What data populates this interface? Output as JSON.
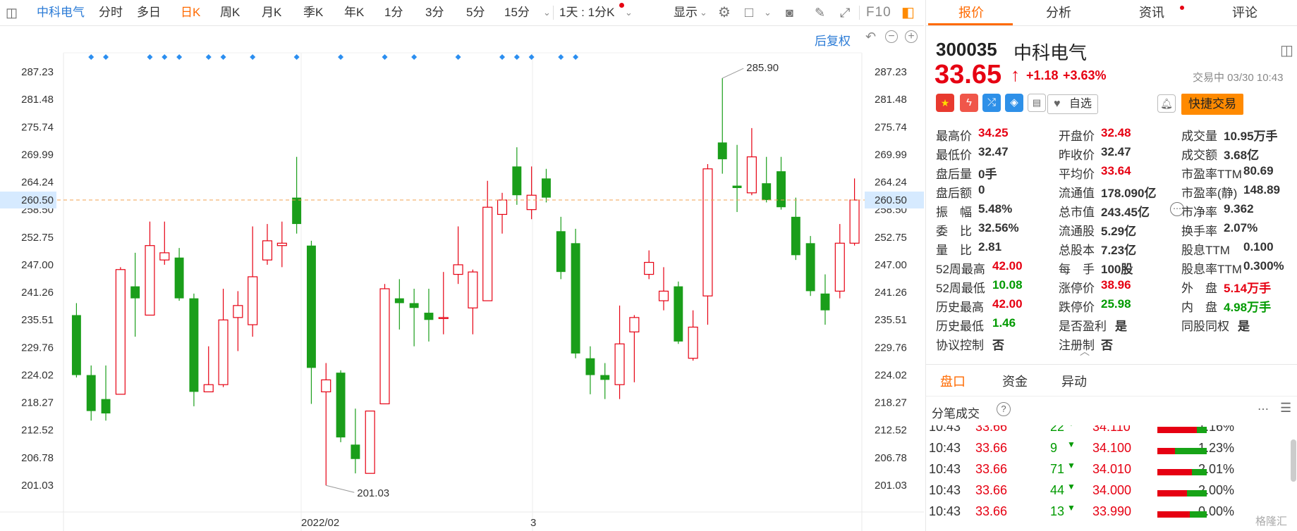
{
  "toolbar": {
    "stock_name": "中科电气",
    "periods": [
      "分时",
      "多日",
      "日K",
      "周K",
      "月K",
      "季K",
      "年K",
      "1分",
      "3分",
      "5分",
      "15分"
    ],
    "active_period": "日K",
    "range_label": "1天 : 1分K",
    "display_label": "显示",
    "f10_label": "F10"
  },
  "chart": {
    "fq_label": "后复权",
    "left_axis": [
      "287.23",
      "281.48",
      "275.74",
      "269.99",
      "264.24",
      "258.50",
      "252.75",
      "247.00",
      "241.26",
      "235.51",
      "229.76",
      "224.02",
      "218.27",
      "212.52",
      "206.78",
      "201.03"
    ],
    "crosshair_value": "260.50",
    "high_label": "285.90",
    "low_label": "201.03",
    "x_labels": [
      "2022/02",
      "3"
    ],
    "colors": {
      "up": "#e60012",
      "down": "#1a9e1a",
      "crosshair": "#f0a050",
      "marker": "#2b8ef0"
    }
  },
  "chart_data": {
    "type": "candlestick",
    "ylim": [
      201.03,
      287.23
    ],
    "candles": [
      {
        "o": 236.5,
        "h": 239.0,
        "l": 223.5,
        "c": 224.0
      },
      {
        "o": 224.0,
        "h": 226.0,
        "l": 214.5,
        "c": 216.5
      },
      {
        "o": 219.0,
        "h": 226.0,
        "l": 214.5,
        "c": 216.0
      },
      {
        "o": 220.0,
        "h": 246.5,
        "l": 220.0,
        "c": 246.0
      },
      {
        "o": 242.5,
        "h": 249.5,
        "l": 232.0,
        "c": 240.0
      },
      {
        "o": 236.5,
        "h": 256.0,
        "l": 236.5,
        "c": 251.0
      },
      {
        "o": 248.0,
        "h": 256.0,
        "l": 247.0,
        "c": 249.5
      },
      {
        "o": 248.5,
        "h": 250.5,
        "l": 239.5,
        "c": 240.0
      },
      {
        "o": 240.0,
        "h": 241.0,
        "l": 217.5,
        "c": 220.5
      },
      {
        "o": 220.5,
        "h": 230.0,
        "l": 220.5,
        "c": 222.0
      },
      {
        "o": 222.0,
        "h": 242.0,
        "l": 221.5,
        "c": 235.5
      },
      {
        "o": 236.0,
        "h": 241.5,
        "l": 229.0,
        "c": 238.5
      },
      {
        "o": 234.5,
        "h": 255.0,
        "l": 232.0,
        "c": 244.5
      },
      {
        "o": 248.0,
        "h": 255.5,
        "l": 247.0,
        "c": 252.0
      },
      {
        "o": 251.0,
        "h": 256.0,
        "l": 246.5,
        "c": 251.5
      },
      {
        "o": 261.0,
        "h": 269.5,
        "l": 253.5,
        "c": 255.5
      },
      {
        "o": 251.0,
        "h": 252.0,
        "l": 218.0,
        "c": 225.5
      },
      {
        "o": 220.5,
        "h": 226.5,
        "l": 201.0,
        "c": 223.0
      },
      {
        "o": 224.5,
        "h": 225.0,
        "l": 210.0,
        "c": 211.0
      },
      {
        "o": 209.5,
        "h": 217.0,
        "l": 203.5,
        "c": 206.5
      },
      {
        "o": 203.5,
        "h": 216.0,
        "l": 203.5,
        "c": 216.5
      },
      {
        "o": 218.0,
        "h": 243.0,
        "l": 218.0,
        "c": 242.0
      },
      {
        "o": 240.0,
        "h": 244.0,
        "l": 233.5,
        "c": 239.0
      },
      {
        "o": 239.0,
        "h": 242.0,
        "l": 230.0,
        "c": 238.0
      },
      {
        "o": 237.0,
        "h": 242.0,
        "l": 231.0,
        "c": 235.5
      },
      {
        "o": 236.0,
        "h": 245.5,
        "l": 232.5,
        "c": 236.0
      },
      {
        "o": 245.0,
        "h": 255.0,
        "l": 243.0,
        "c": 247.0
      },
      {
        "o": 238.0,
        "h": 246.0,
        "l": 232.5,
        "c": 245.5
      },
      {
        "o": 239.5,
        "h": 264.5,
        "l": 239.5,
        "c": 259.0
      },
      {
        "o": 257.5,
        "h": 262.0,
        "l": 253.5,
        "c": 260.5
      },
      {
        "o": 267.5,
        "h": 271.5,
        "l": 259.5,
        "c": 261.5
      },
      {
        "o": 258.5,
        "h": 267.5,
        "l": 256.5,
        "c": 261.5
      },
      {
        "o": 265.0,
        "h": 267.0,
        "l": 260.0,
        "c": 261.0
      },
      {
        "o": 254.0,
        "h": 257.0,
        "l": 244.0,
        "c": 245.5
      },
      {
        "o": 251.5,
        "h": 254.5,
        "l": 227.5,
        "c": 228.5
      },
      {
        "o": 227.5,
        "h": 230.0,
        "l": 220.0,
        "c": 224.0
      },
      {
        "o": 224.0,
        "h": 226.5,
        "l": 219.0,
        "c": 223.0
      },
      {
        "o": 222.0,
        "h": 238.5,
        "l": 219.0,
        "c": 230.5
      },
      {
        "o": 233.0,
        "h": 236.5,
        "l": 222.5,
        "c": 236.0
      },
      {
        "o": 245.0,
        "h": 250.0,
        "l": 244.0,
        "c": 247.5
      },
      {
        "o": 239.5,
        "h": 246.5,
        "l": 237.5,
        "c": 241.5
      },
      {
        "o": 242.5,
        "h": 243.5,
        "l": 230.5,
        "c": 231.0
      },
      {
        "o": 227.5,
        "h": 237.5,
        "l": 227.0,
        "c": 234.0
      },
      {
        "o": 240.5,
        "h": 268.0,
        "l": 234.5,
        "c": 267.0
      },
      {
        "o": 272.5,
        "h": 285.9,
        "l": 266.0,
        "c": 269.0
      },
      {
        "o": 263.5,
        "h": 272.0,
        "l": 258.0,
        "c": 263.0
      },
      {
        "o": 262.0,
        "h": 275.5,
        "l": 261.5,
        "c": 269.5
      },
      {
        "o": 264.0,
        "h": 269.5,
        "l": 260.0,
        "c": 260.5
      },
      {
        "o": 266.5,
        "h": 269.5,
        "l": 258.5,
        "c": 259.0
      },
      {
        "o": 257.0,
        "h": 261.0,
        "l": 248.0,
        "c": 249.0
      },
      {
        "o": 251.5,
        "h": 253.0,
        "l": 240.5,
        "c": 241.5
      },
      {
        "o": 241.0,
        "h": 245.0,
        "l": 234.5,
        "c": 237.5
      },
      {
        "o": 241.5,
        "h": 255.5,
        "l": 240.0,
        "c": 251.5
      },
      {
        "o": 251.5,
        "h": 265.0,
        "l": 251.0,
        "c": 260.5
      }
    ],
    "markers_index": [
      1,
      2,
      5,
      6,
      7,
      9,
      10,
      12,
      15,
      18,
      21,
      23,
      26,
      29,
      30,
      31,
      33,
      34
    ]
  },
  "tabs": [
    "报价",
    "分析",
    "资讯",
    "评论"
  ],
  "quote": {
    "code": "300035",
    "name": "中科电气",
    "price": "33.65",
    "arrow": "↑",
    "change": "+1.18",
    "change_pct": "+3.63%",
    "status": "交易中 03/30 10:43",
    "zixuan": "自选",
    "quick_trade": "快捷交易",
    "fields_col1": [
      {
        "k": "最高价",
        "v": "34.25",
        "cls": "red"
      },
      {
        "k": "最低价",
        "v": "32.47",
        "cls": ""
      },
      {
        "k": "盘后量",
        "v": "0手",
        "cls": ""
      },
      {
        "k": "盘后额",
        "v": "0",
        "cls": ""
      },
      {
        "k": "振　幅",
        "v": "5.48%",
        "cls": ""
      },
      {
        "k": "委　比",
        "v": "32.56%",
        "cls": ""
      },
      {
        "k": "量　比",
        "v": "2.81",
        "cls": ""
      },
      {
        "k": "52周最高",
        "v": "42.00",
        "cls": "red"
      },
      {
        "k": "52周最低",
        "v": "10.08",
        "cls": "green"
      },
      {
        "k": "历史最高",
        "v": "42.00",
        "cls": "red"
      },
      {
        "k": "历史最低",
        "v": "1.46",
        "cls": "green"
      },
      {
        "k": "协议控制",
        "v": "否",
        "cls": ""
      }
    ],
    "fields_col2": [
      {
        "k": "开盘价",
        "v": "32.48",
        "cls": "red"
      },
      {
        "k": "昨收价",
        "v": "32.47",
        "cls": ""
      },
      {
        "k": "平均价",
        "v": "33.64",
        "cls": "red"
      },
      {
        "k": "流通值",
        "v": "178.090亿",
        "cls": ""
      },
      {
        "k": "总市值",
        "v": "243.45亿",
        "cls": ""
      },
      {
        "k": "流通股",
        "v": "5.29亿",
        "cls": ""
      },
      {
        "k": "总股本",
        "v": "7.23亿",
        "cls": ""
      },
      {
        "k": "每　手",
        "v": "100股",
        "cls": ""
      },
      {
        "k": "涨停价",
        "v": "38.96",
        "cls": "red"
      },
      {
        "k": "跌停价",
        "v": "25.98",
        "cls": "green"
      },
      {
        "k": "是否盈利",
        "v": "是",
        "cls": ""
      },
      {
        "k": "注册制",
        "v": "否",
        "cls": ""
      }
    ],
    "fields_col3": [
      {
        "k": "成交量",
        "v": "10.95万手",
        "cls": ""
      },
      {
        "k": "成交额",
        "v": "3.68亿",
        "cls": ""
      },
      {
        "k": "市盈率TTM",
        "v": "80.69",
        "cls": ""
      },
      {
        "k": "市盈率(静)",
        "v": "148.89",
        "cls": ""
      },
      {
        "k": "市净率",
        "v": "9.362",
        "cls": ""
      },
      {
        "k": "换手率",
        "v": "2.07%",
        "cls": ""
      },
      {
        "k": "股息TTM",
        "v": "0.100",
        "cls": ""
      },
      {
        "k": "股息率TTM",
        "v": "0.300%",
        "cls": ""
      },
      {
        "k": "外　盘",
        "v": "5.14万手",
        "cls": "red"
      },
      {
        "k": "内　盘",
        "v": "4.98万手",
        "cls": "green"
      },
      {
        "k": "同股同权",
        "v": "是",
        "cls": ""
      }
    ]
  },
  "subtabs": [
    "盘口",
    "资金",
    "异动"
  ],
  "ticks": {
    "title": "分笔成交",
    "rows": [
      {
        "t": "10:43",
        "p": "33.66",
        "v": "22",
        "lp": "34.110",
        "pct": "1.16%",
        "rf": 0.8,
        "gf": 0.2
      },
      {
        "t": "10:43",
        "p": "33.66",
        "v": "9",
        "lp": "34.100",
        "pct": "1.23%",
        "rf": 0.35,
        "gf": 0.65
      },
      {
        "t": "10:43",
        "p": "33.66",
        "v": "71",
        "lp": "34.010",
        "pct": "2.01%",
        "rf": 0.7,
        "gf": 0.3
      },
      {
        "t": "10:43",
        "p": "33.66",
        "v": "44",
        "lp": "34.000",
        "pct": "2.00%",
        "rf": 0.6,
        "gf": 0.4
      },
      {
        "t": "10:43",
        "p": "33.66",
        "v": "13",
        "lp": "33.990",
        "pct": "0.00%",
        "rf": 0.65,
        "gf": 0.35
      }
    ],
    "watermark": "格隆汇"
  }
}
